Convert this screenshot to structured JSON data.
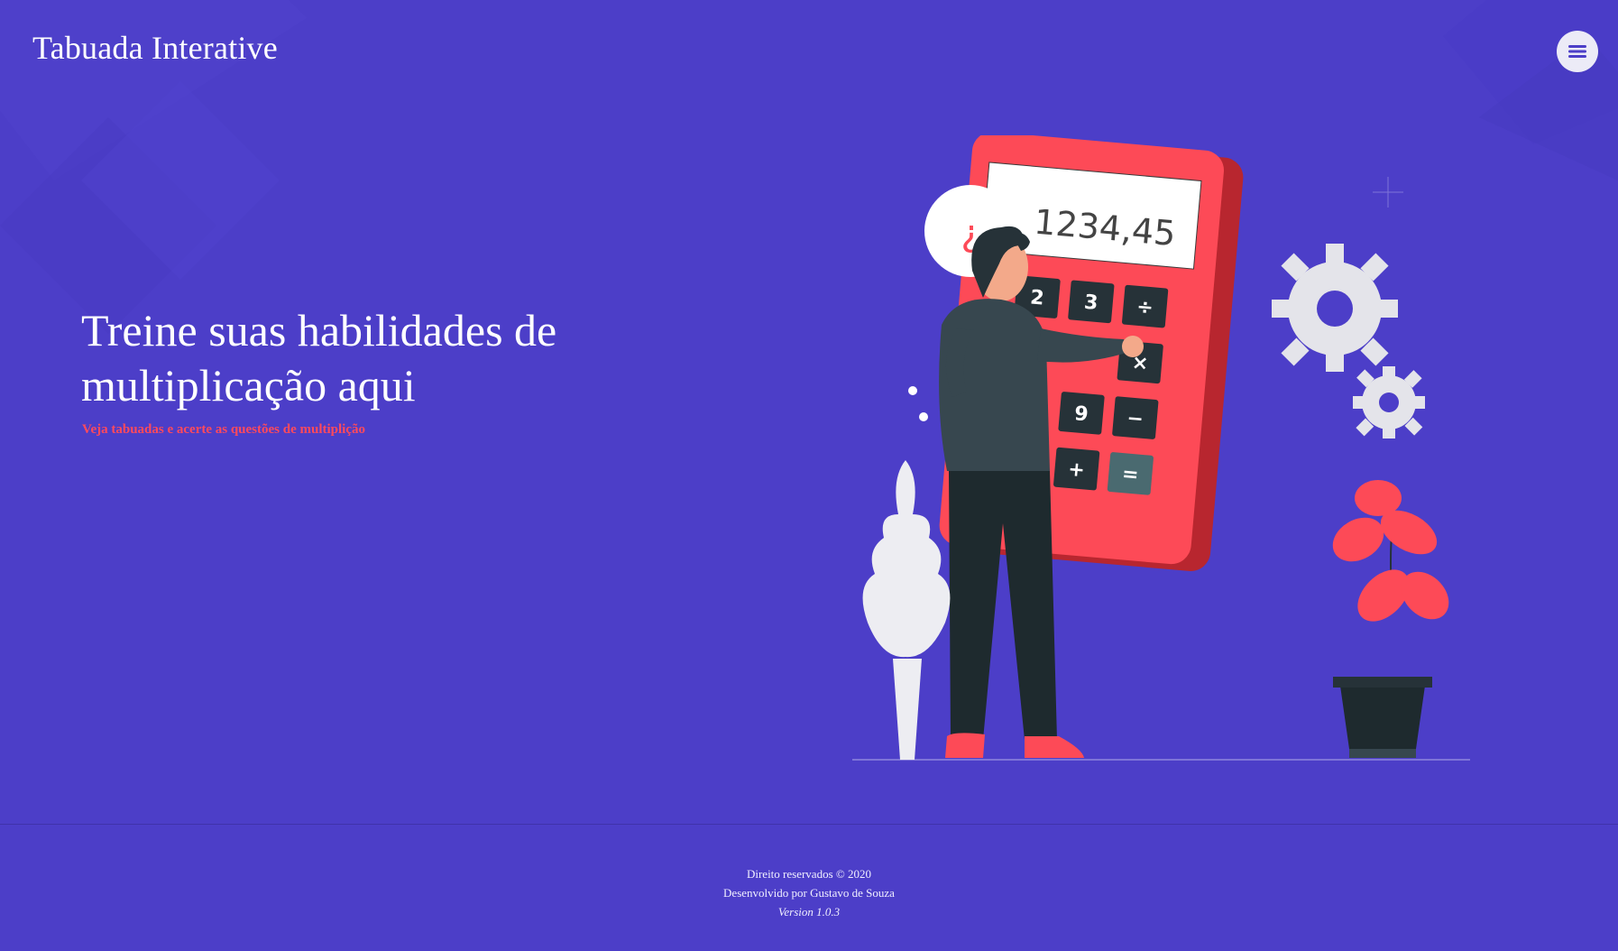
{
  "header": {
    "brand": "Tabuada Interative",
    "menu_icon": "hamburger-icon"
  },
  "hero": {
    "title": "Treine suas habilidades de multiplicação aqui",
    "subtitle": "Veja tabuadas e acerte as questões de multiplição"
  },
  "illustration": {
    "display_value": "1234,45",
    "bubble_symbol": "¿",
    "keys": [
      "2",
      "3",
      "÷",
      "×",
      "9",
      "−",
      "+",
      "="
    ]
  },
  "footer": {
    "rights": "Direito reservados © 2020",
    "author": "Desenvolvido por Gustavo de Souza",
    "version": "Version 1.0.3"
  },
  "colors": {
    "background": "#4c3ec8",
    "accent": "#ff4a5c",
    "menu_button": "#ecebf7"
  }
}
